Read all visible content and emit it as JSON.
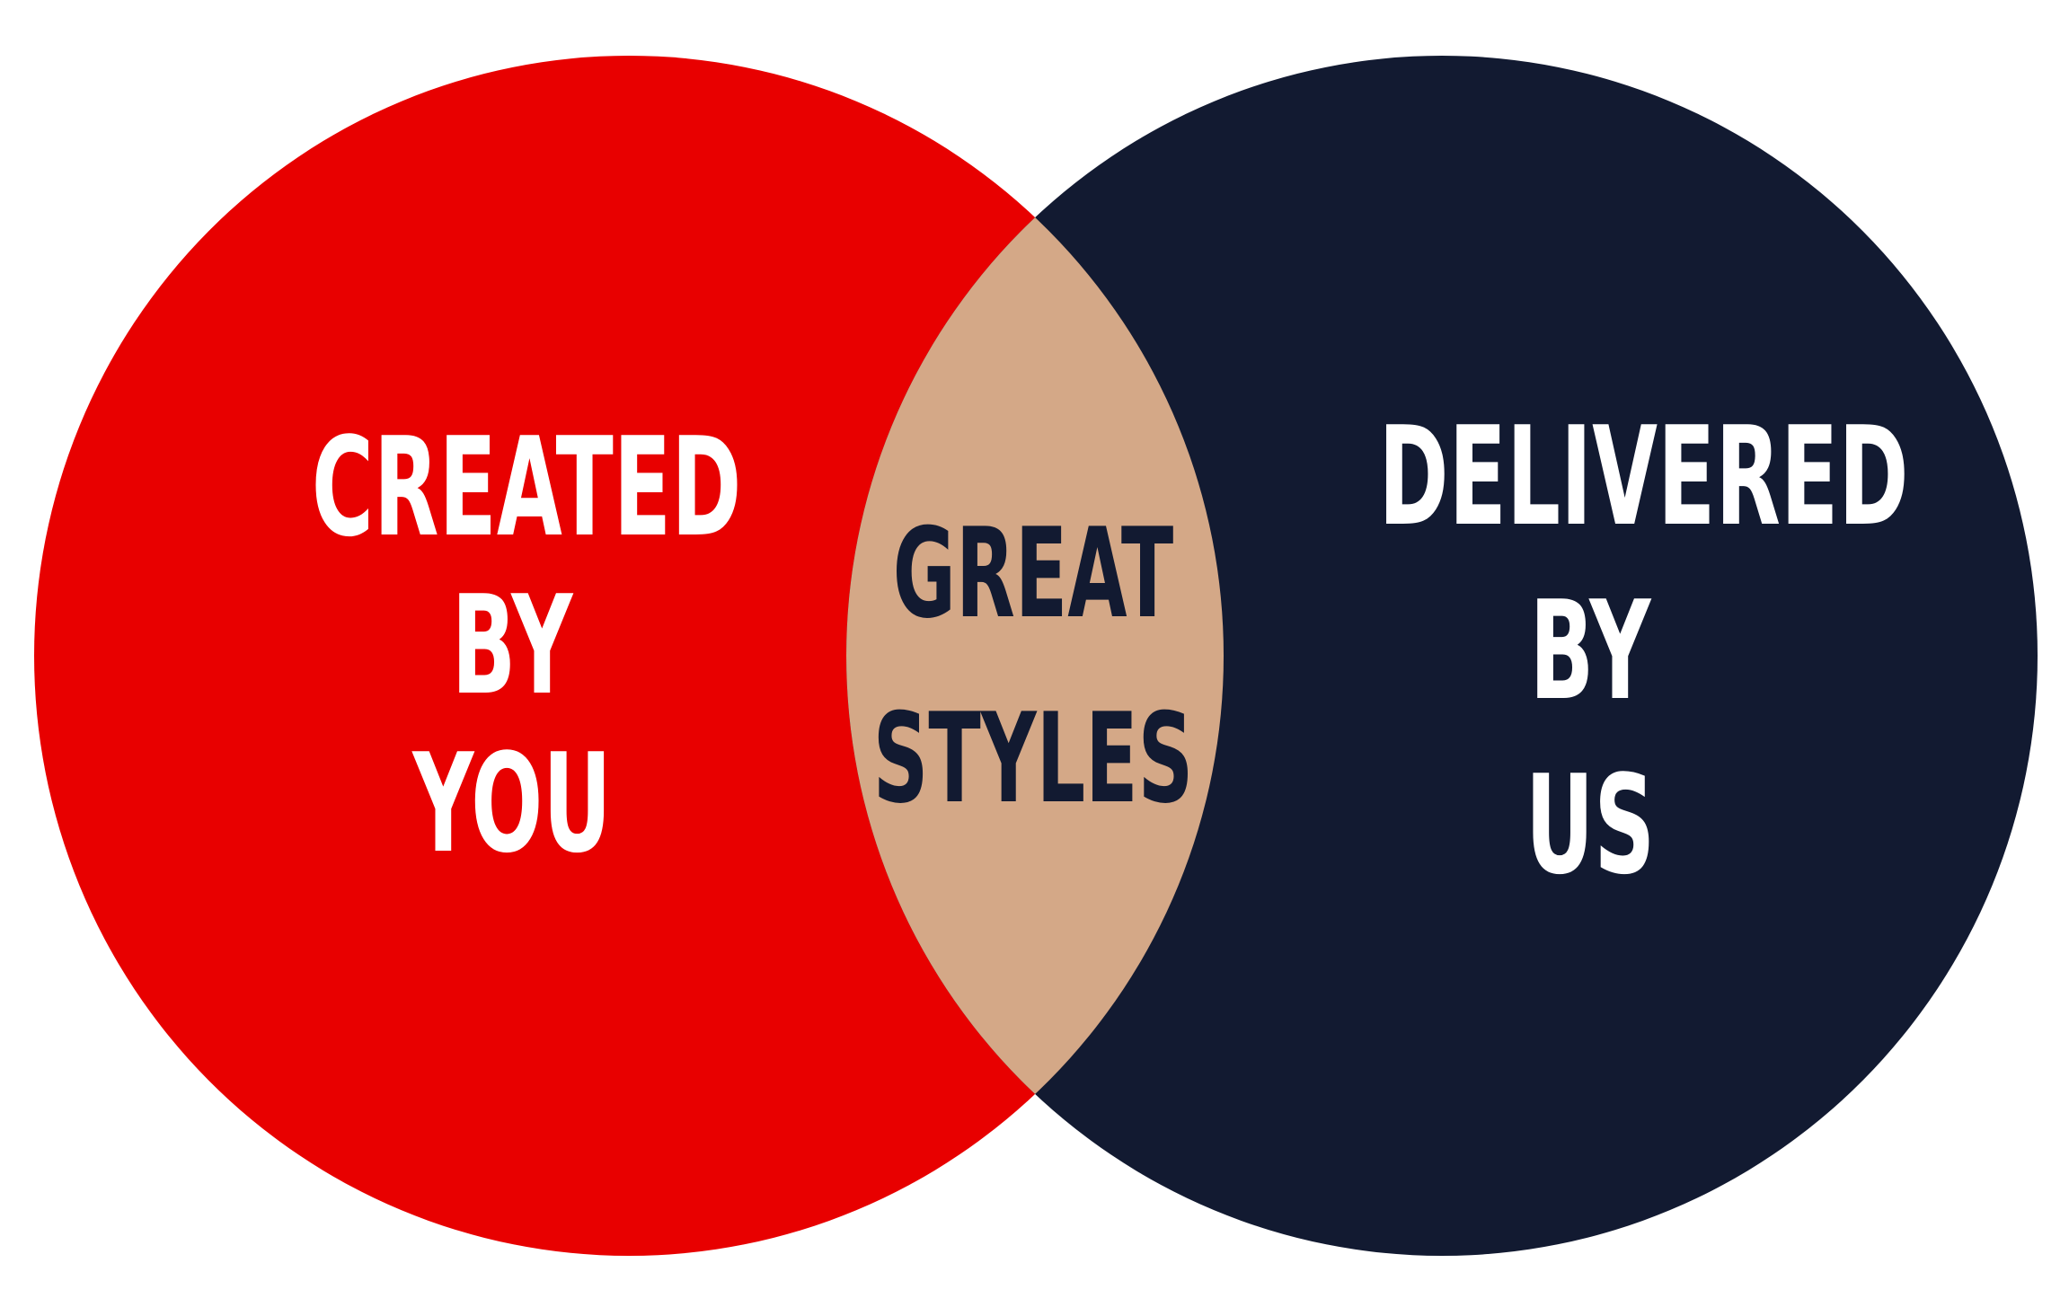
{
  "diagram": {
    "type": "venn",
    "colors": {
      "left_circle": "#e80000",
      "right_circle": "#121a31",
      "intersection": "#d4a887",
      "left_text": "#ffffff",
      "right_text": "#ffffff",
      "center_text": "#121a31"
    },
    "left": {
      "lines": [
        "CREATED",
        "BY",
        "YOU"
      ]
    },
    "right": {
      "lines": [
        "DELIVERED",
        "BY",
        "US"
      ]
    },
    "center": {
      "lines": [
        "GREAT",
        "STYLES"
      ]
    }
  }
}
